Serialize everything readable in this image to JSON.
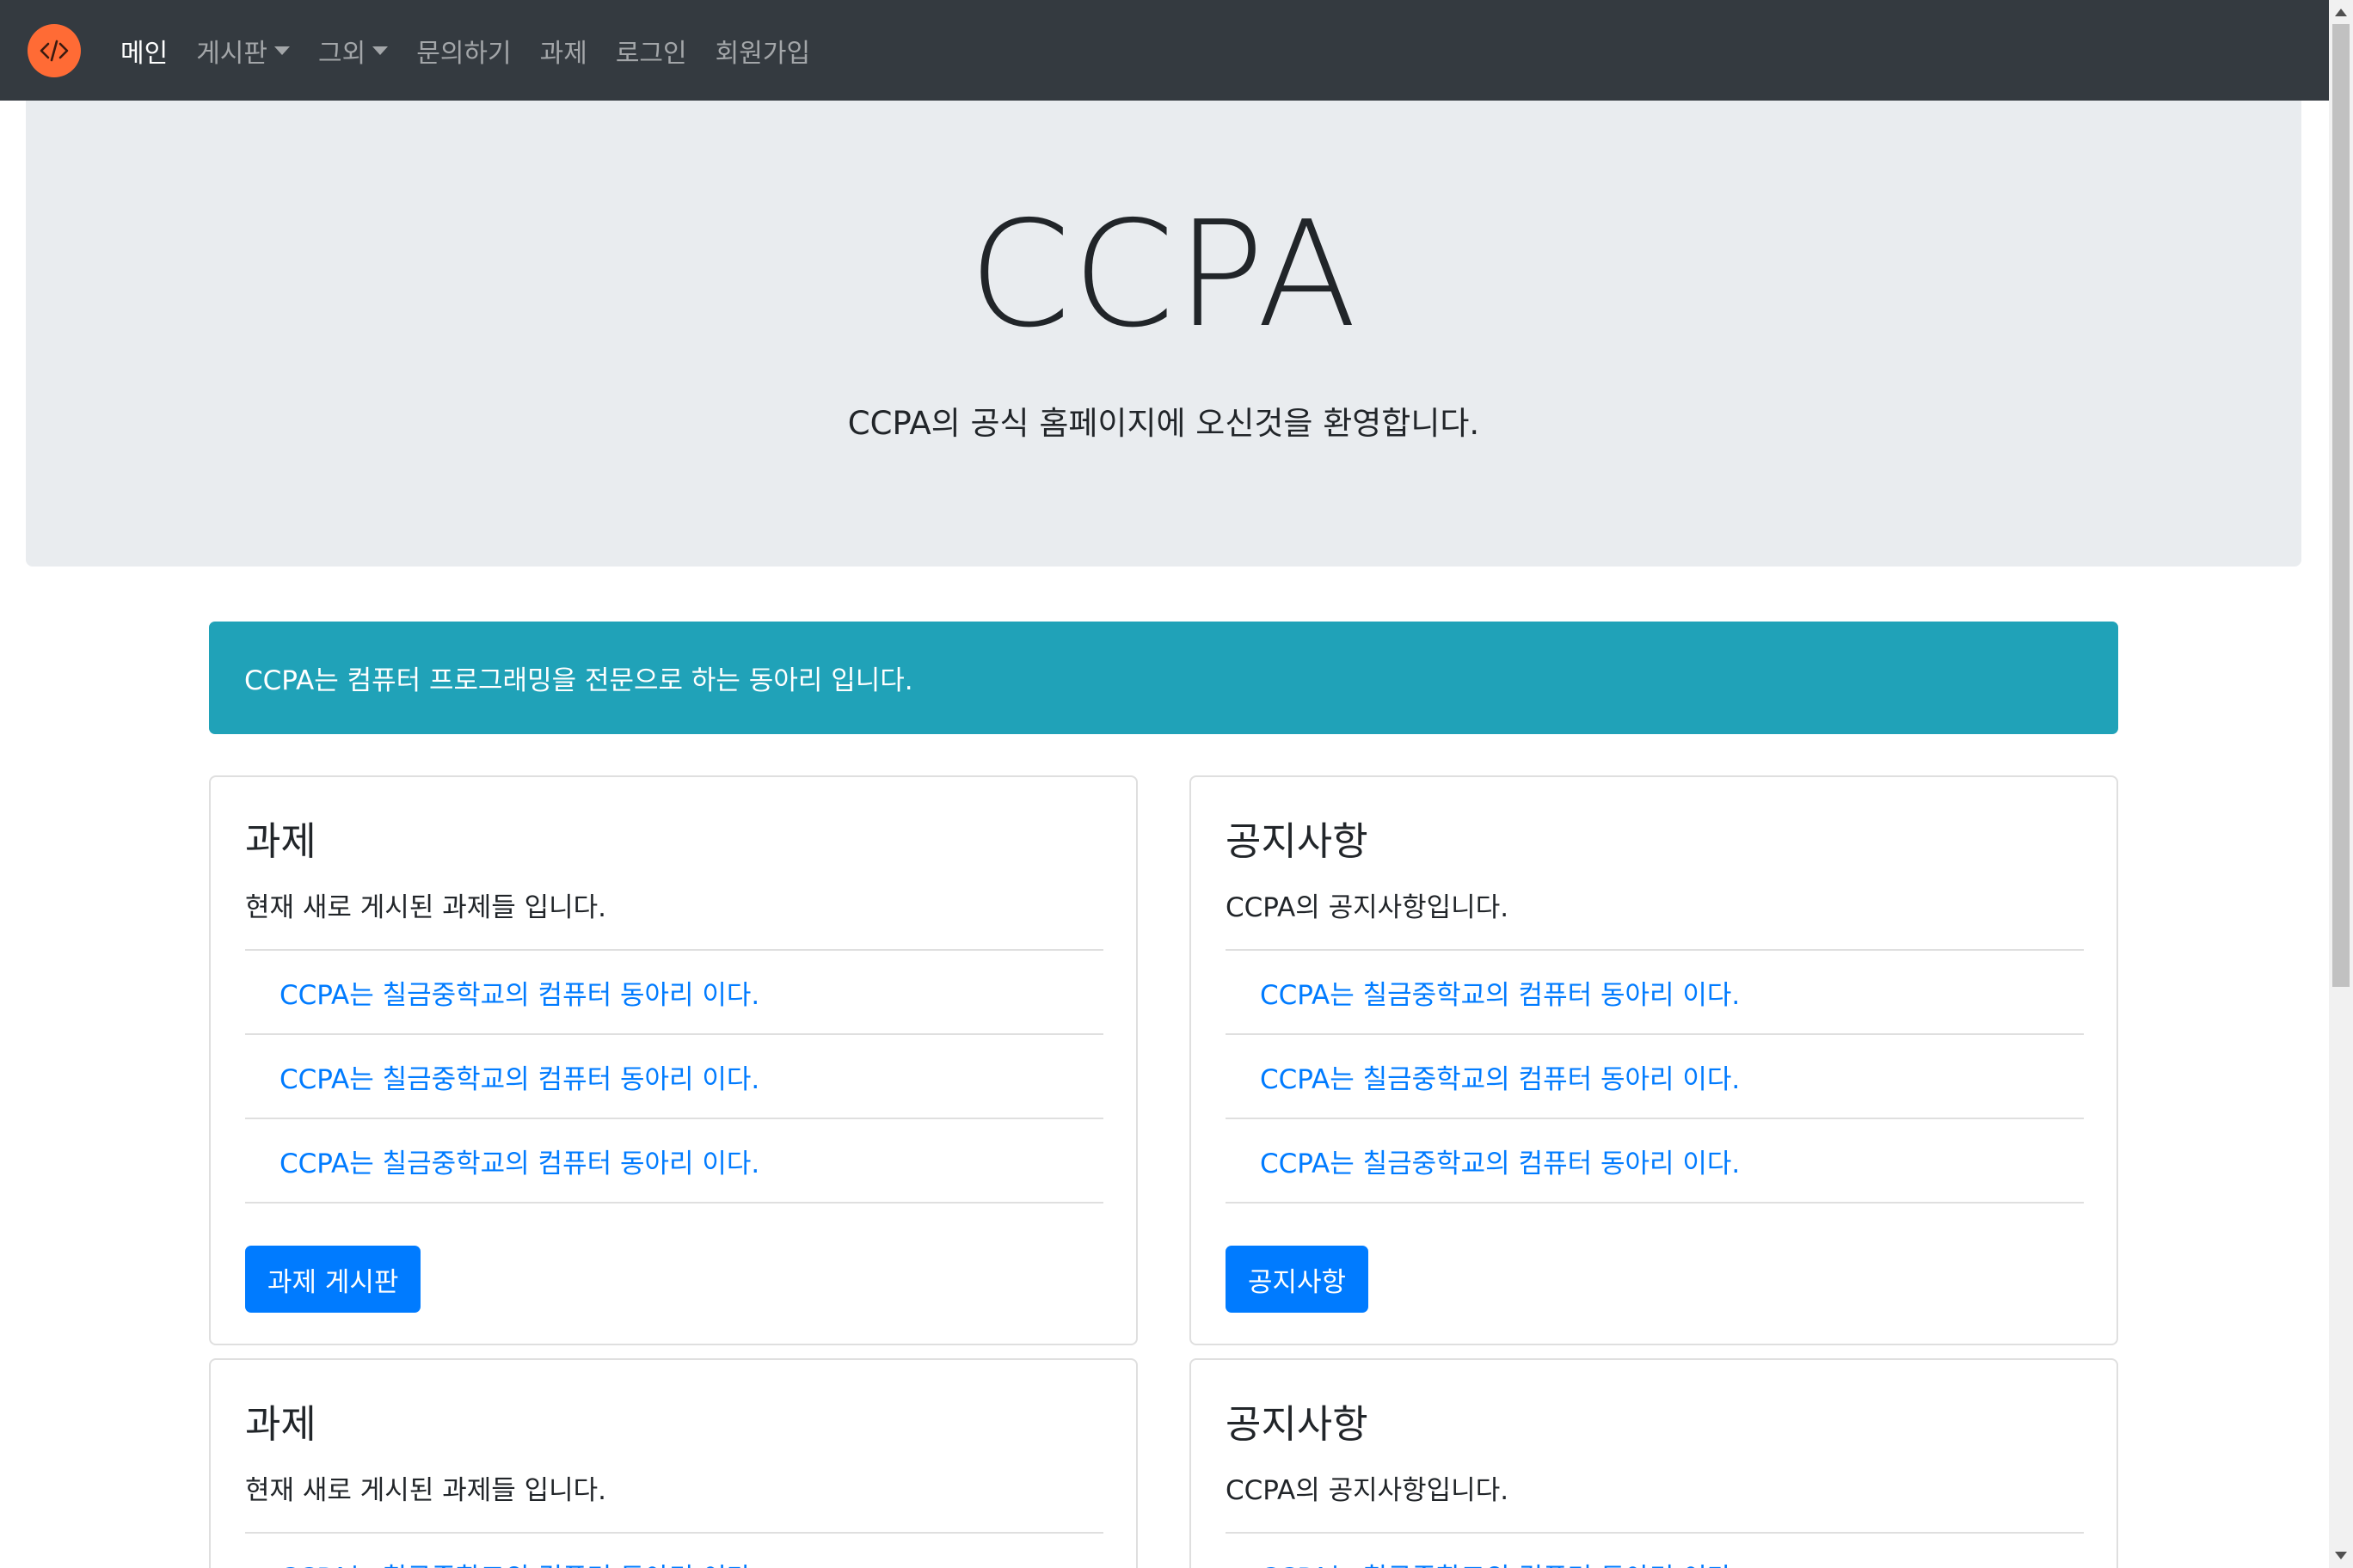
{
  "navbar": {
    "brand_icon": "code-icon",
    "items": [
      {
        "label": "메인",
        "active": true
      },
      {
        "label": "게시판",
        "dropdown": true
      },
      {
        "label": "그외",
        "dropdown": true
      },
      {
        "label": "문의하기"
      },
      {
        "label": "과제"
      },
      {
        "label": "로그인"
      },
      {
        "label": "회원가입"
      }
    ]
  },
  "jumbotron": {
    "title": "CCPA",
    "lead": "CCPA의 공식 홈페이지에 오신것을 환영합니다."
  },
  "alert": {
    "text": "CCPA는 컴퓨터 프로그래밍을 전문으로 하는 동아리 입니다."
  },
  "cards": [
    {
      "title": "과제",
      "text": "현재 새로 게시된 과제들 입니다.",
      "items": [
        "CCPA는 칠금중학교의 컴퓨터 동아리 이다.",
        "CCPA는 칠금중학교의 컴퓨터 동아리 이다.",
        "CCPA는 칠금중학교의 컴퓨터 동아리 이다."
      ],
      "button": "과제 게시판"
    },
    {
      "title": "공지사항",
      "text": "CCPA의 공지사항입니다.",
      "items": [
        "CCPA는 칠금중학교의 컴퓨터 동아리 이다.",
        "CCPA는 칠금중학교의 컴퓨터 동아리 이다.",
        "CCPA는 칠금중학교의 컴퓨터 동아리 이다."
      ],
      "button": "공지사항"
    },
    {
      "title": "과제",
      "text": "현재 새로 게시된 과제들 입니다.",
      "items": [
        "CCPA는 칠금중학교의 컴퓨터 동아리 이다."
      ]
    },
    {
      "title": "공지사항",
      "text": "CCPA의 공지사항입니다.",
      "items": [
        "CCPA는 칠금중학교의 컴퓨터 동아리 이다."
      ]
    }
  ],
  "colors": {
    "navbar": "#343a40",
    "brand": "#ff6b35",
    "jumbotron": "#e9ecef",
    "alert": "#20a2b8",
    "link": "#007bff",
    "button": "#007bff"
  }
}
